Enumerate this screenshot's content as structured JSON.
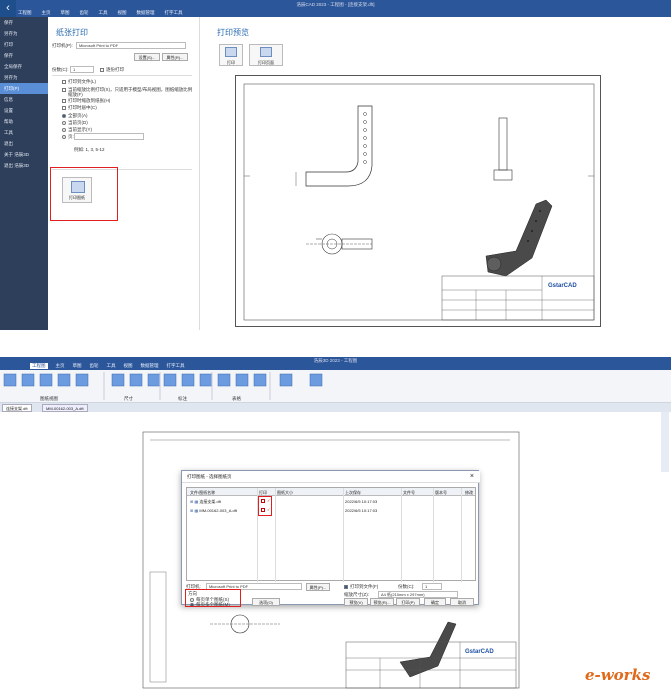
{
  "top": {
    "window_title": "浩辰CAD 2023 - 工程图 - [连接支架.dft]",
    "menu": [
      "文件",
      "工程图",
      "主页",
      "草图",
      "齿轮",
      "工具",
      "视图",
      "数据管理",
      "打字工具"
    ],
    "sidebar": [
      "保存",
      "另存为",
      "打印",
      "保存",
      "全局保存",
      "另存为",
      "打印(P)",
      "信息",
      "设置",
      "帮助",
      "工具",
      "退出",
      "关于 浩辰3D",
      "退出 浩辰3D"
    ],
    "panel_title": "纸张打印",
    "printer_label": "打印机(P):",
    "printer_value": "Microsoft Print to PDF",
    "btn_setup": "设置(S)...",
    "btn_props": "属性(R)...",
    "copies_label": "份数(C):",
    "copies_value": "1",
    "collate_label": "逐份打印",
    "print_to_file": "打印到文件(L)",
    "opt_scale": "当前缩放比例打印(X)，只适用于模型/布局视图，图纸缩放比例",
    "opt_scale_cont": "缩放(F)",
    "opt_fit": "打印时缩放到纸张(H)",
    "opt_center": "打印时居中(C)",
    "range_all": "全部页(A)",
    "range_current": "当前页(D)",
    "range_sel": "当前显示(Y)",
    "range_pages": "页:",
    "range_example": "例如: 1, 3, 5-12",
    "batch_label": "打印图纸",
    "preview_title": "打印预览",
    "preview_print": "打印",
    "preview_page": "打印页面"
  },
  "bottom": {
    "window_title": "浩辰3D 2023 - 工程图",
    "menu": [
      "工程图",
      "主页",
      "草图",
      "齿轮",
      "工具",
      "视图",
      "数据管理",
      "打字工具"
    ],
    "ribbon_groups": [
      "图纸视图",
      "尺寸",
      "标注",
      "表格"
    ],
    "toolbar_items": [
      "视图布局",
      "注释",
      "尺寸"
    ],
    "doc_tabs": [
      "连接支架.dft",
      "MM-00162-003_A.dft"
    ],
    "dialog_title": "打印图纸 - 选择图纸页",
    "columns": [
      "文件/图纸名称",
      "打印",
      "图纸大小",
      "上次保存",
      "文件号",
      "版本号",
      "修改"
    ],
    "rows": [
      {
        "name": "连接支架.dft",
        "checked": true,
        "date": "2022/6/5 10:17:03"
      },
      {
        "name": "MM-00162-003_A.dft",
        "checked": true,
        "date": "2022/6/5 10:17:03"
      }
    ],
    "printer_label": "打印机:",
    "printer_value": "Microsoft Print to PDF",
    "props": "属性(P)...",
    "print_to_file": "打印到文件(F)",
    "copies_label": "份数(C):",
    "copies_value": "1",
    "scale_label": "缩放尺寸(Z):",
    "scale_value": "A4 纸(210mm x 297mm)",
    "orientation_label": "方向",
    "opt_single": "每页单个图纸(S)",
    "opt_multi": "每页多个图纸(M)",
    "btn_select": "选项(O)",
    "btn_preview": "预览(V)",
    "btn_preview2": "预览(R)...",
    "btn_print": "打印(P)",
    "btn_ok": "确定",
    "btn_cancel": "取消",
    "watermark": "e-works",
    "logo": "GstarCAD"
  },
  "colors": {
    "accent": "#2b579a",
    "highlight": "#e02020"
  }
}
